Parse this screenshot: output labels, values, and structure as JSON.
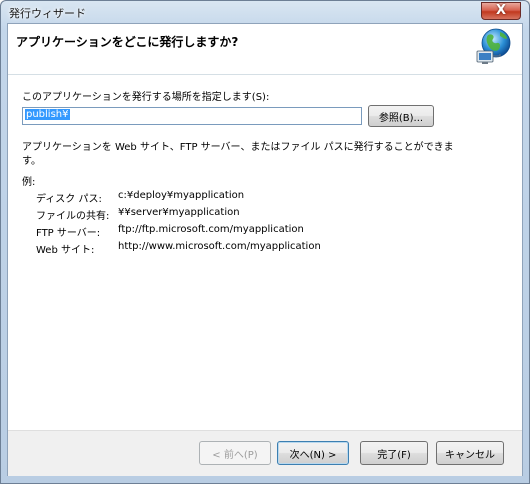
{
  "window": {
    "title": "発行ウィザード",
    "close_label": "X"
  },
  "header": {
    "title": "アプリケーションをどこに発行しますか?",
    "icon": "globe-network-icon"
  },
  "location": {
    "label": "このアプリケーションを発行する場所を指定します(S):",
    "value": "publish¥",
    "browse_label": "参照(B)..."
  },
  "description": {
    "line1": "アプリケーションを Web サイト、FTP サーバー、またはファイル パスに発行することができま",
    "line2": "す。"
  },
  "examples": {
    "heading": "例:",
    "items": [
      {
        "type": "ディスク パス:",
        "value": "c:¥deploy¥myapplication"
      },
      {
        "type": "ファイルの共有:",
        "value": "¥¥server¥myapplication"
      },
      {
        "type": "FTP サーバー:",
        "value": "ftp://ftp.microsoft.com/myapplication"
      },
      {
        "type": "Web サイト:",
        "value": "http://www.microsoft.com/myapplication"
      }
    ]
  },
  "footer": {
    "back_label": "< 前へ(P)",
    "next_label": "次へ(N) >",
    "finish_label": "完了(F)",
    "cancel_label": "キャンセル"
  },
  "colors": {
    "selection": "#3399ff",
    "close_button": "#c1391f",
    "frame": "#c3d6ea"
  }
}
